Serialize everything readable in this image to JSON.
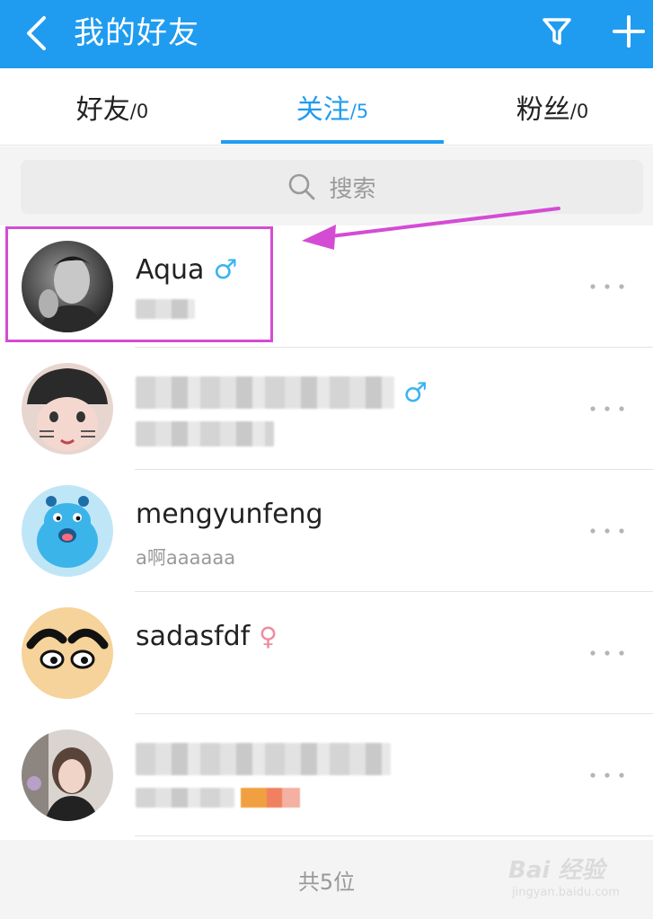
{
  "header": {
    "title": "我的好友",
    "back_icon": "chevron-left-icon",
    "filter_icon": "filter-icon",
    "add_icon": "plus-icon",
    "bar_color": "#1f9cf0"
  },
  "tabs": [
    {
      "label": "好友",
      "count": "/0",
      "active": false
    },
    {
      "label": "关注",
      "count": "/5",
      "active": true
    },
    {
      "label": "粉丝",
      "count": "/0",
      "active": false
    }
  ],
  "search": {
    "placeholder": "搜索",
    "icon": "search-icon"
  },
  "contacts": [
    {
      "name": "Aqua",
      "gender": "♂",
      "subtitle": "",
      "avatar": "photo-man-avatar"
    },
    {
      "name": "",
      "gender": "♂",
      "subtitle": "",
      "avatar": "cartoon-girl-avatar"
    },
    {
      "name": "mengyunfeng",
      "gender": "",
      "subtitle": "a啊aaaaaa",
      "avatar": "blue-monster-avatar"
    },
    {
      "name": "sadasfdf",
      "gender": "♀",
      "subtitle": "",
      "avatar": "cartoon-face-avatar"
    },
    {
      "name": "",
      "gender": "",
      "subtitle": "",
      "avatar": "photo-girl-avatar"
    }
  ],
  "footer": {
    "total": "共5位"
  },
  "watermark": {
    "title": "Bai 经验",
    "subtitle": "jingyan.baidu.com"
  },
  "colors": {
    "accent": "#1f9cf0",
    "male": "#3ab4f2",
    "female": "#f08aa0",
    "annotation": "#d44cd4"
  }
}
